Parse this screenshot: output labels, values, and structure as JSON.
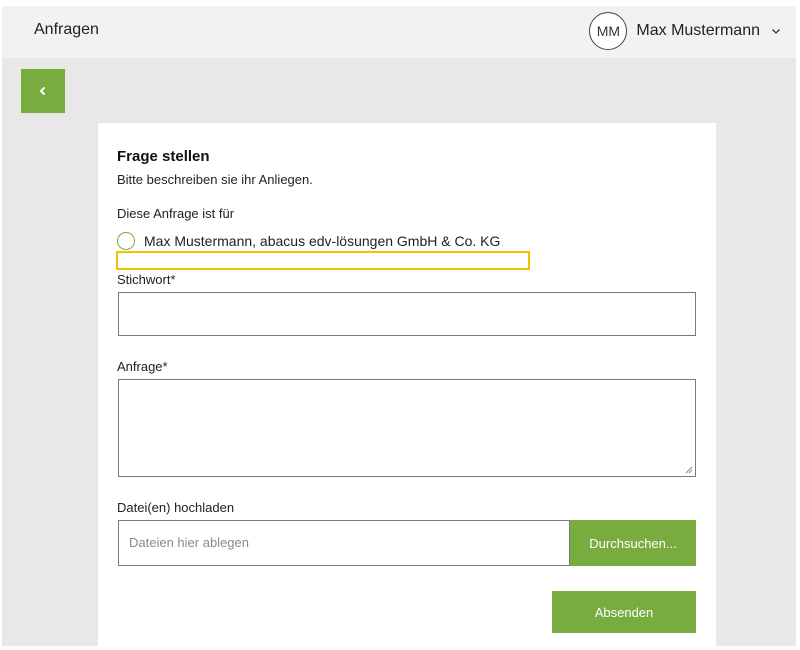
{
  "header": {
    "title": "Anfragen",
    "user_initials": "MM",
    "user_name": "Max Mustermann"
  },
  "icons": {
    "back": "chevron-left-icon",
    "user_menu": "chevron-down-icon",
    "resize": "resize-handle-icon"
  },
  "form": {
    "title": "Frage stellen",
    "subtitle": "Bitte beschreiben sie ihr Anliegen.",
    "recipient_label": "Diese Anfrage ist für",
    "recipient_option": "Max Mustermann, abacus edv-lösungen GmbH & Co. KG",
    "keyword_label": "Stichwort*",
    "keyword_value": "",
    "request_label": "Anfrage*",
    "request_value": "",
    "upload_label": "Datei(en) hochladen",
    "upload_placeholder": "Dateien hier ablegen",
    "browse_label": "Durchsuchen...",
    "submit_label": "Absenden"
  },
  "colors": {
    "accent_green": "#79ac3f",
    "highlight_yellow": "#f2c200",
    "background_gray": "#e8e8e8"
  }
}
